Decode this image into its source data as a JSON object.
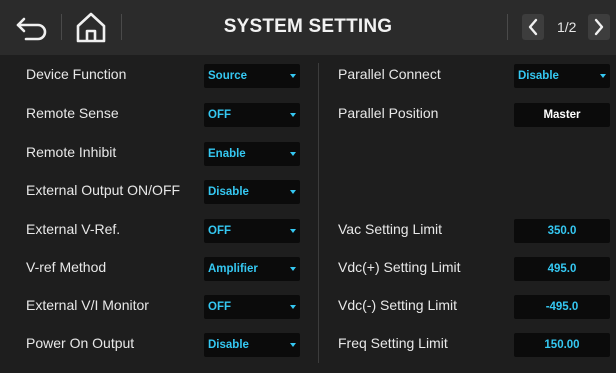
{
  "header": {
    "title": "SYSTEM SETTING",
    "page_indicator": "1/2"
  },
  "left": [
    {
      "label": "Device Function",
      "value": "Source"
    },
    {
      "label": "Remote Sense",
      "value": "OFF"
    },
    {
      "label": "Remote Inhibit",
      "value": "Enable"
    },
    {
      "label": "External Output ON/OFF",
      "value": "Disable"
    },
    {
      "label": "External V-Ref.",
      "value": "OFF"
    },
    {
      "label": "V-ref Method",
      "value": "Amplifier"
    },
    {
      "label": "External V/I Monitor",
      "value": "OFF"
    },
    {
      "label": "Power On Output",
      "value": "Disable"
    }
  ],
  "right": {
    "parallel_connect": {
      "label": "Parallel Connect",
      "value": "Disable"
    },
    "parallel_position": {
      "label": "Parallel Position",
      "value": "Master"
    },
    "vac_limit": {
      "label": "Vac Setting Limit",
      "value": "350.0"
    },
    "vdc_pos_limit": {
      "label": "Vdc(+) Setting Limit",
      "value": "495.0"
    },
    "vdc_neg_limit": {
      "label": "Vdc(-) Setting Limit",
      "value": "-495.0"
    },
    "freq_limit": {
      "label": "Freq Setting Limit",
      "value": "150.00"
    }
  },
  "colors": {
    "background": "#1e1e1e",
    "header": "#2b2b2b",
    "field": "#0b0b0b",
    "accent": "#35c8f2"
  },
  "icons": [
    "back-arrow-icon",
    "home-icon",
    "chevron-left-icon",
    "chevron-right-icon",
    "dropdown-arrow-icon"
  ]
}
